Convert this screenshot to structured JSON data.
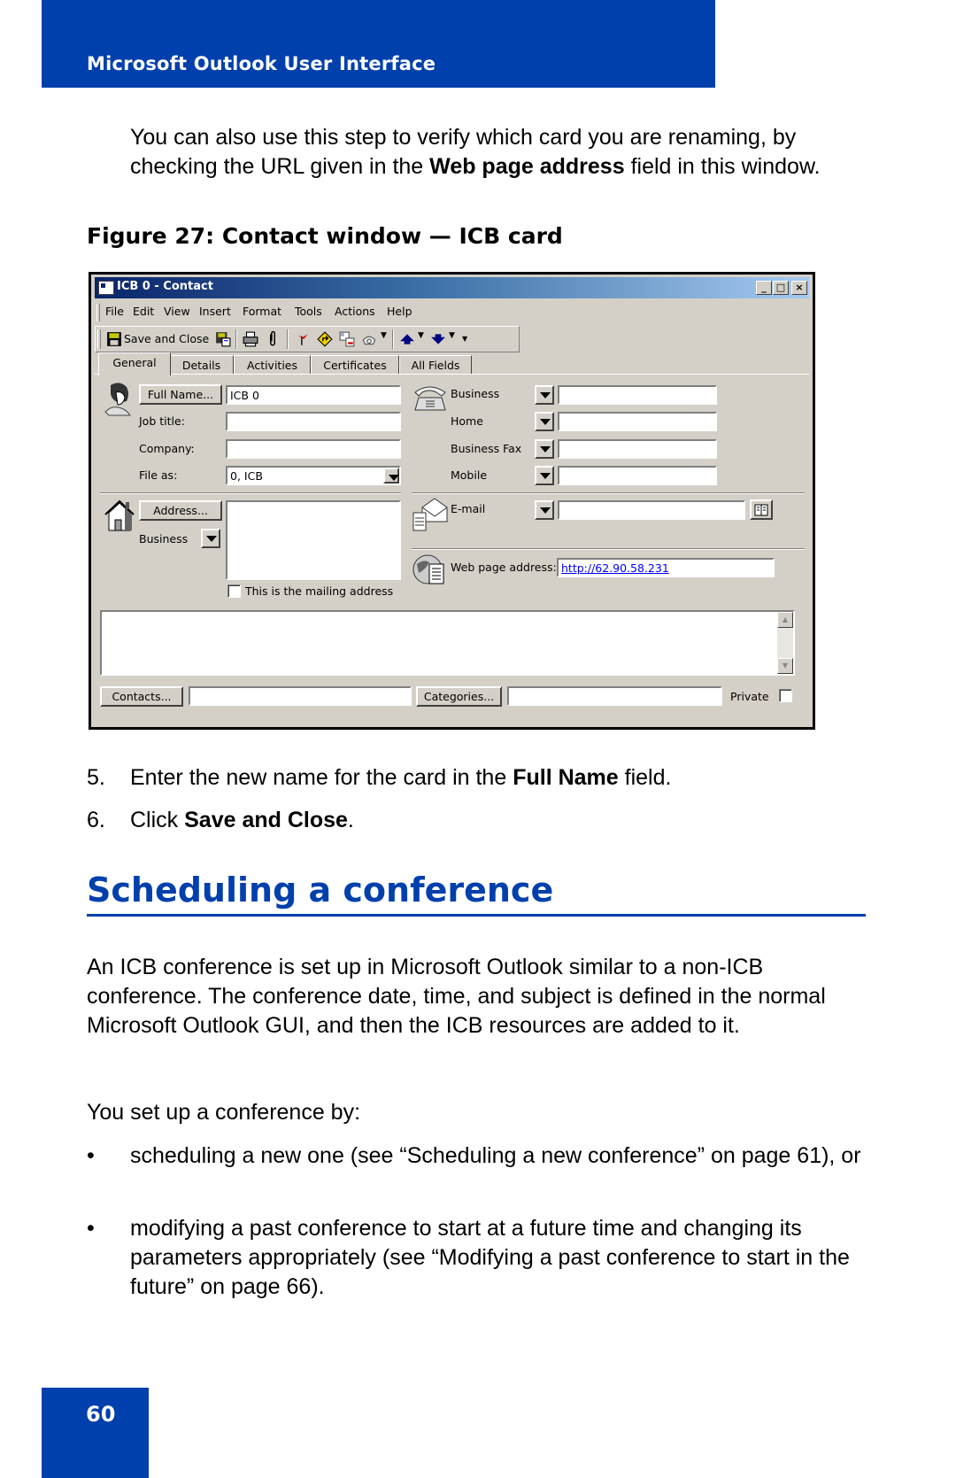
{
  "header": {
    "title": "Microsoft Outlook User Interface"
  },
  "intro": {
    "before": "You can also use this step to verify which card you are renaming, by checking the URL given in the ",
    "bold": "Web page address",
    "after": " field in this window."
  },
  "figure_caption": "Figure 27: Contact window — ICB card",
  "window": {
    "title": "ICB 0 - Contact",
    "caption_buttons": {
      "minimize": "_",
      "maximize": "□",
      "close": "×"
    },
    "menu": [
      "File",
      "Edit",
      "View",
      "Insert",
      "Format",
      "Tools",
      "Actions",
      "Help"
    ],
    "toolbar": {
      "save_and_close": "Save and Close",
      "icons": [
        "save-icon",
        "save-as-icon",
        "print-icon",
        "attach-icon",
        "flag-icon",
        "follow-up-icon",
        "new-meeting-icon",
        "phone-dial-icon",
        "previous-item-icon",
        "next-item-icon"
      ]
    },
    "tabs": [
      "General",
      "Details",
      "Activities",
      "Certificates",
      "All Fields"
    ],
    "active_tab": "General",
    "general": {
      "full_name_button": "Full Name...",
      "full_name_value": "ICB 0",
      "job_title_label": "Job title:",
      "job_title_value": "",
      "company_label": "Company:",
      "company_value": "",
      "file_as_label": "File as:",
      "file_as_value": "0, ICB",
      "address_button": "Address...",
      "address_type": "Business",
      "address_value": "",
      "mailing_address_label": "This is the mailing address",
      "mailing_address_checked": false,
      "phones": [
        {
          "label": "Business",
          "value": ""
        },
        {
          "label": "Home",
          "value": ""
        },
        {
          "label": "Business Fax",
          "value": ""
        },
        {
          "label": "Mobile",
          "value": ""
        }
      ],
      "email_label": "E-mail",
      "email_value": "",
      "web_label": "Web page address:",
      "web_value": "http://62.90.58.231",
      "notes_value": "",
      "contacts_button": "Contacts...",
      "contacts_value": "",
      "categories_button": "Categories...",
      "categories_value": "",
      "private_label": "Private",
      "private_checked": false
    }
  },
  "steps": [
    {
      "num": "5.",
      "before": "Enter the new name for the card in the ",
      "bold": "Full Name",
      "after": " field."
    },
    {
      "num": "6.",
      "before": "Click ",
      "bold": "Save and Close",
      "after": "."
    }
  ],
  "section": {
    "title": "Scheduling a conference",
    "para1": "An ICB conference is set up in Microsoft Outlook similar to a non-ICB conference. The conference date, time, and subject is defined in the normal Microsoft Outlook GUI, and then the ICB resources are added to it.",
    "para2": "You set up a conference by:",
    "bullets": [
      "scheduling a new one (see “Scheduling a new conference” on page 61), or",
      "modifying a past conference to start at a future time and changing its parameters appropriately (see “Modifying a past conference to start in the future” on page 66)."
    ],
    "bullet_glyph": "•"
  },
  "page_number": "60",
  "colors": {
    "brand_blue": "#0040ad",
    "window_face": "#d4d0c8",
    "link": "#0000ff"
  }
}
